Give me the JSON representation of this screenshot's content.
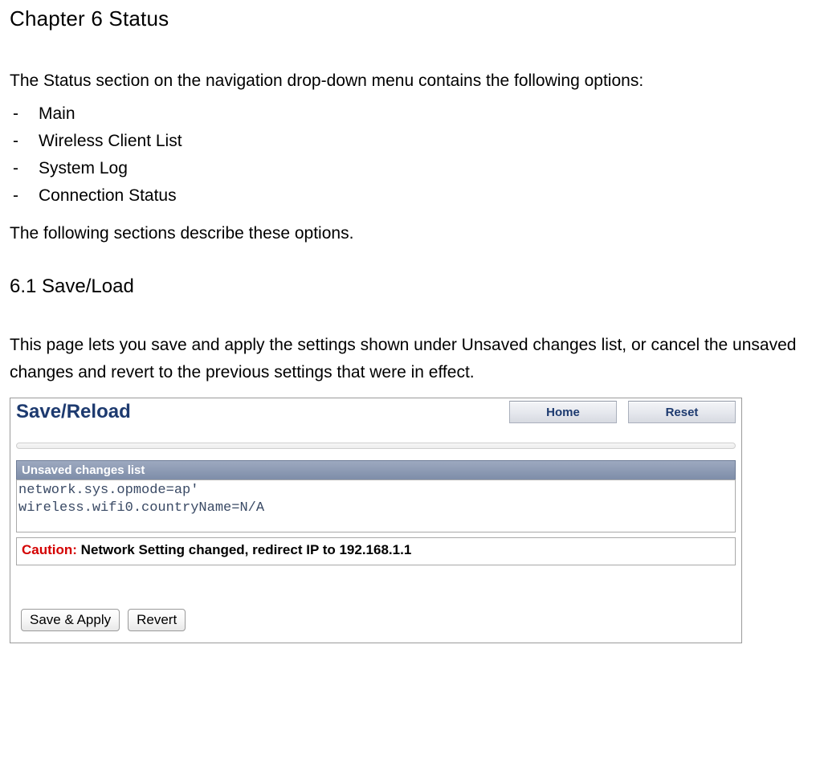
{
  "chapter": {
    "title": "Chapter 6 Status",
    "intro": "The Status section on the navigation drop-down menu contains the following options:",
    "bullets": [
      "Main",
      "Wireless Client List",
      "System Log",
      "Connection Status"
    ],
    "descline": "The following sections describe these options."
  },
  "section": {
    "title": "6.1 Save/Load",
    "desc": "This page lets you save and apply the settings shown under Unsaved changes list, or cancel the unsaved changes and revert to the previous settings that were in effect."
  },
  "panel": {
    "heading": "Save/Reload",
    "home_label": "Home",
    "reset_label": "Reset",
    "band_label": "Unsaved changes list",
    "code": "network.sys.opmode=ap'\nwireless.wifi0.countryName=N/A",
    "caution_label": "Caution:",
    "caution_msg": "  Network Setting changed, redirect IP to 192.168.1.1",
    "save_label": "Save & Apply",
    "revert_label": "Revert"
  }
}
